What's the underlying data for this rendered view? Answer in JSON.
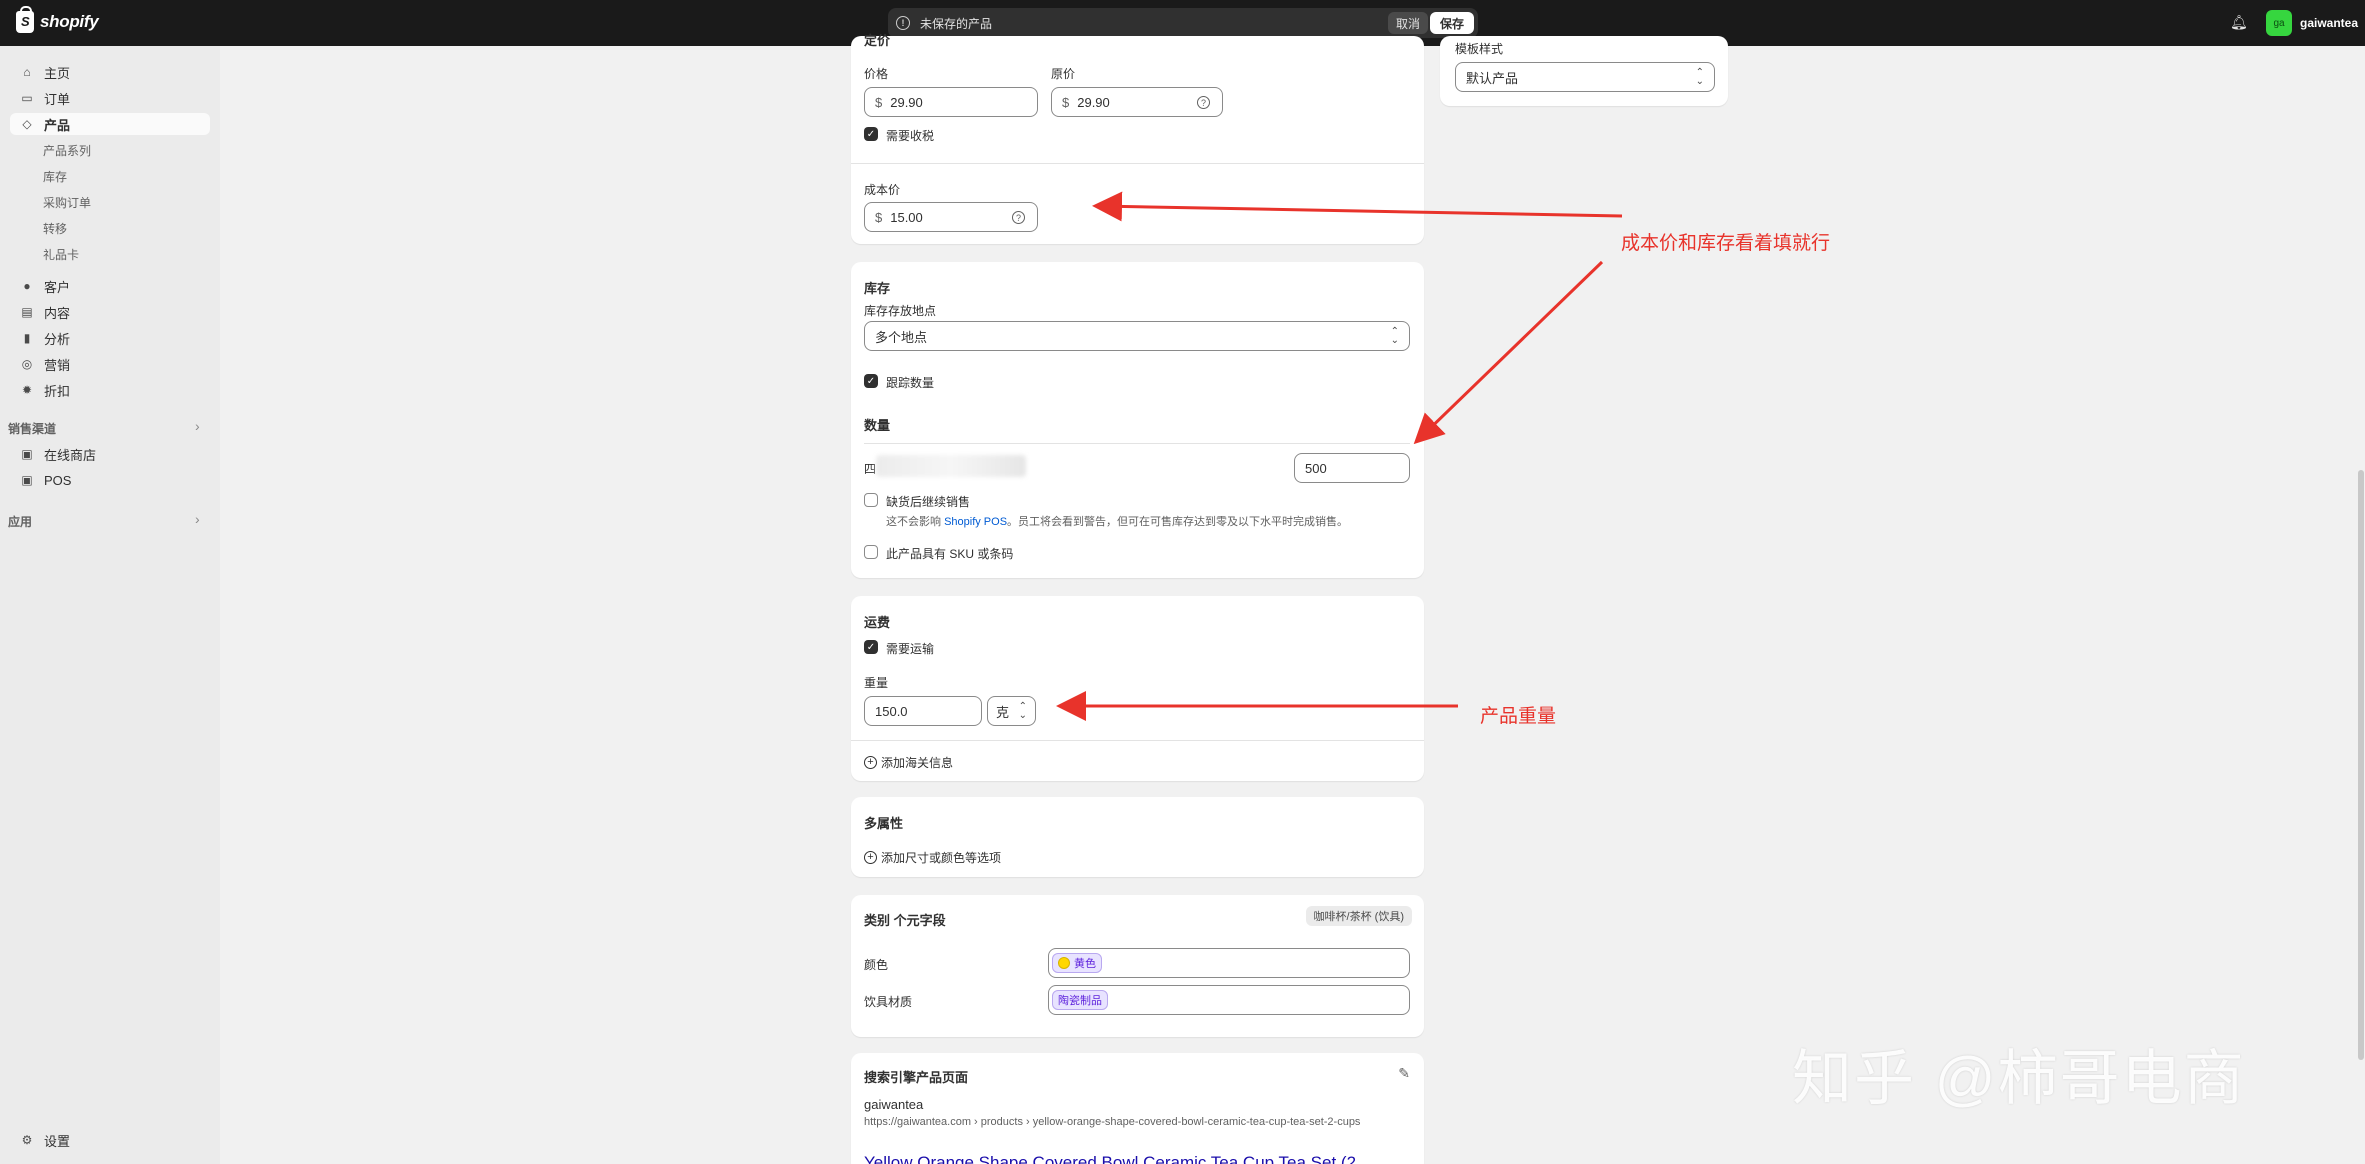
{
  "topbar": {
    "logo_text": "shopify",
    "savebar_text": "未保存的产品",
    "discard_label": "取消",
    "save_label": "保存",
    "store_avatar": "ga",
    "store_name": "gaiwantea"
  },
  "sidebar": {
    "items": [
      {
        "label": "主页",
        "icon": "home-icon"
      },
      {
        "label": "订单",
        "icon": "inbox-icon"
      },
      {
        "label": "产品",
        "icon": "tag-icon"
      }
    ],
    "product_sub": [
      "产品系列",
      "库存",
      "采购订单",
      "转移",
      "礼品卡"
    ],
    "items2": [
      {
        "label": "客户",
        "icon": "person-icon"
      },
      {
        "label": "内容",
        "icon": "content-icon"
      },
      {
        "label": "分析",
        "icon": "chart-icon"
      },
      {
        "label": "营销",
        "icon": "target-icon"
      },
      {
        "label": "折扣",
        "icon": "discount-icon"
      }
    ],
    "sales_channels_label": "销售渠道",
    "channels": [
      {
        "label": "在线商店",
        "icon": "store-icon"
      },
      {
        "label": "POS",
        "icon": "pos-icon"
      }
    ],
    "apps_label": "应用",
    "settings_label": "设置"
  },
  "pricing": {
    "section_title": "定价",
    "price_label": "价格",
    "price_value": "29.90",
    "compare_label": "原价",
    "compare_value": "29.90",
    "currency": "$",
    "charge_tax_label": "需要收税",
    "cost_label": "成本价",
    "cost_value": "15.00"
  },
  "template": {
    "label": "模板样式",
    "value": "默认产品"
  },
  "inventory": {
    "title": "库存",
    "location_label": "库存存放地点",
    "location_value": "多个地点",
    "track_label": "跟踪数量",
    "quantity_title": "数量",
    "quantity_row_label": "四",
    "quantity_value": "500",
    "continue_selling_label": "缺货后继续销售",
    "continue_note_pre": "这不会影响 ",
    "continue_note_link": "Shopify POS",
    "continue_note_post": "。员工将会看到警告，但可在可售库存达到零及以下水平时完成销售。",
    "sku_label": "此产品具有 SKU 或条码"
  },
  "shipping": {
    "title": "运费",
    "requires_label": "需要运输",
    "weight_label": "重量",
    "weight_value": "150.0",
    "weight_unit": "克",
    "customs_label": "添加海关信息"
  },
  "variants": {
    "title": "多属性",
    "add_label": "添加尺寸或颜色等选项"
  },
  "metafields": {
    "title": "类别 个元字段",
    "category_badge": "咖啡杯/茶杯 (饮具)",
    "color_label": "颜色",
    "color_value": "黄色",
    "color_swatch": "#ffd700",
    "material_label": "饮具材质",
    "material_value": "陶瓷制品"
  },
  "seo": {
    "title": "搜索引擎产品页面",
    "store": "gaiwantea",
    "url": "https://gaiwantea.com › products › yellow-orange-shape-covered-bowl-ceramic-tea-cup-tea-set-2-cups",
    "page_title": "Yellow Orange Shape Covered Bowl Ceramic Tea Cup Tea Set (2"
  },
  "annotations": {
    "note1": "成本价和库存看着填就行",
    "note2": "产品重量",
    "color": "#e8332b"
  },
  "watermark": "知乎 @柿哥电商"
}
